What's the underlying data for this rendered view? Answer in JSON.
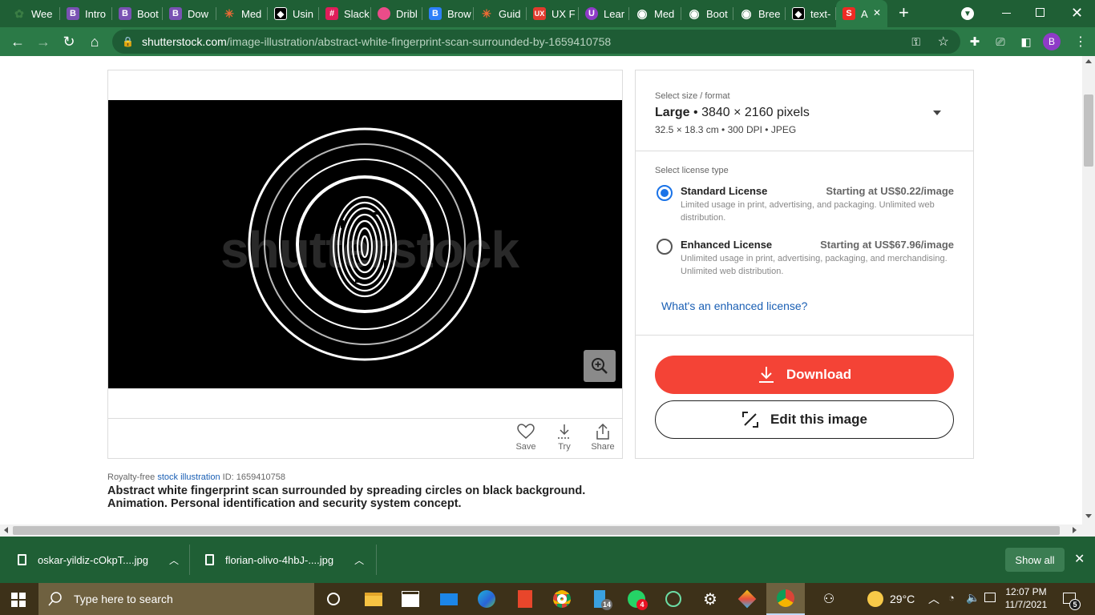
{
  "browser": {
    "tabs": [
      {
        "label": "Wee",
        "icon": "plant-icon",
        "color": "#3a7d44"
      },
      {
        "label": "Intro",
        "icon": "bootstrap-icon",
        "color": "#7952b3"
      },
      {
        "label": "Boot",
        "icon": "bootstrap-icon",
        "color": "#7952b3"
      },
      {
        "label": "Dow",
        "icon": "bootstrap-icon",
        "color": "#7952b3"
      },
      {
        "label": "Med",
        "icon": "asterisk-icon",
        "color": "#f06a35"
      },
      {
        "label": "Usin",
        "icon": "cube-icon",
        "color": "#000000"
      },
      {
        "label": "Slack",
        "icon": "slack-icon",
        "color": "#e01e5a"
      },
      {
        "label": "Dribl",
        "icon": "dribbble-icon",
        "color": "#ea4c89"
      },
      {
        "label": "Brow",
        "icon": "bs-icon",
        "color": "#2d7ff9"
      },
      {
        "label": "Guid",
        "icon": "asterisk-icon",
        "color": "#f06a35"
      },
      {
        "label": "UX F",
        "icon": "ux-icon",
        "color": "#e23b2e"
      },
      {
        "label": "Lear",
        "icon": "u-icon",
        "color": "#8e3bc7"
      },
      {
        "label": "Med",
        "icon": "globe-icon",
        "color": "#ffffff"
      },
      {
        "label": "Boot",
        "icon": "globe-icon",
        "color": "#ffffff"
      },
      {
        "label": "Bree",
        "icon": "globe-icon",
        "color": "#ffffff"
      },
      {
        "label": "text-",
        "icon": "cube-icon",
        "color": "#000000"
      },
      {
        "label": "A",
        "icon": "shutterstock-icon",
        "color": "#ee2b24",
        "active": true
      }
    ],
    "address": {
      "host": "shutterstock.com",
      "path": "/image-illustration/abstract-white-fingerprint-scan-surrounded-by-1659410758"
    },
    "profile_letter": "B"
  },
  "image": {
    "watermark": "shutterstock",
    "actions": [
      {
        "label": "Save",
        "icon": "heart-icon"
      },
      {
        "label": "Try",
        "icon": "download-dashed-icon"
      },
      {
        "label": "Share",
        "icon": "share-icon"
      }
    ]
  },
  "caption": {
    "prefix": "Royalty-free ",
    "type_link": "stock illustration",
    "id_text": " ID: 1659410758",
    "title": "Abstract white fingerprint scan surrounded by spreading circles on black background. Animation. Personal identification and security system concept."
  },
  "panel": {
    "size_label": "Select size / format",
    "size_name": "Large",
    "size_pixels": " • 3840 × 2160 pixels",
    "size_details": "32.5 × 18.3 cm • 300 DPI • JPEG",
    "license_label": "Select license type",
    "licenses": [
      {
        "title": "Standard License",
        "price": "Starting at US$0.22/image",
        "desc": "Limited usage in print, advertising, and packaging. Unlimited web distribution.",
        "selected": true
      },
      {
        "title": "Enhanced License",
        "price": "Starting at US$67.96/image",
        "desc": "Unlimited usage in print, advertising, packaging, and merchandising. Unlimited web distribution.",
        "selected": false
      }
    ],
    "enhanced_link": "What's an enhanced license?",
    "download_label": "Download",
    "edit_label": "Edit this image",
    "accent": "#f44336"
  },
  "downloads": {
    "items": [
      "oskar-yildiz-cOkpT....jpg",
      "florian-olivo-4hbJ-....jpg"
    ],
    "show_all": "Show all"
  },
  "taskbar": {
    "search_placeholder": "Type here to search",
    "weather": "29°C",
    "time": "12:07 PM",
    "date": "11/7/2021",
    "badges": {
      "files": "14",
      "whatsapp": "4",
      "notifications": "5"
    }
  }
}
